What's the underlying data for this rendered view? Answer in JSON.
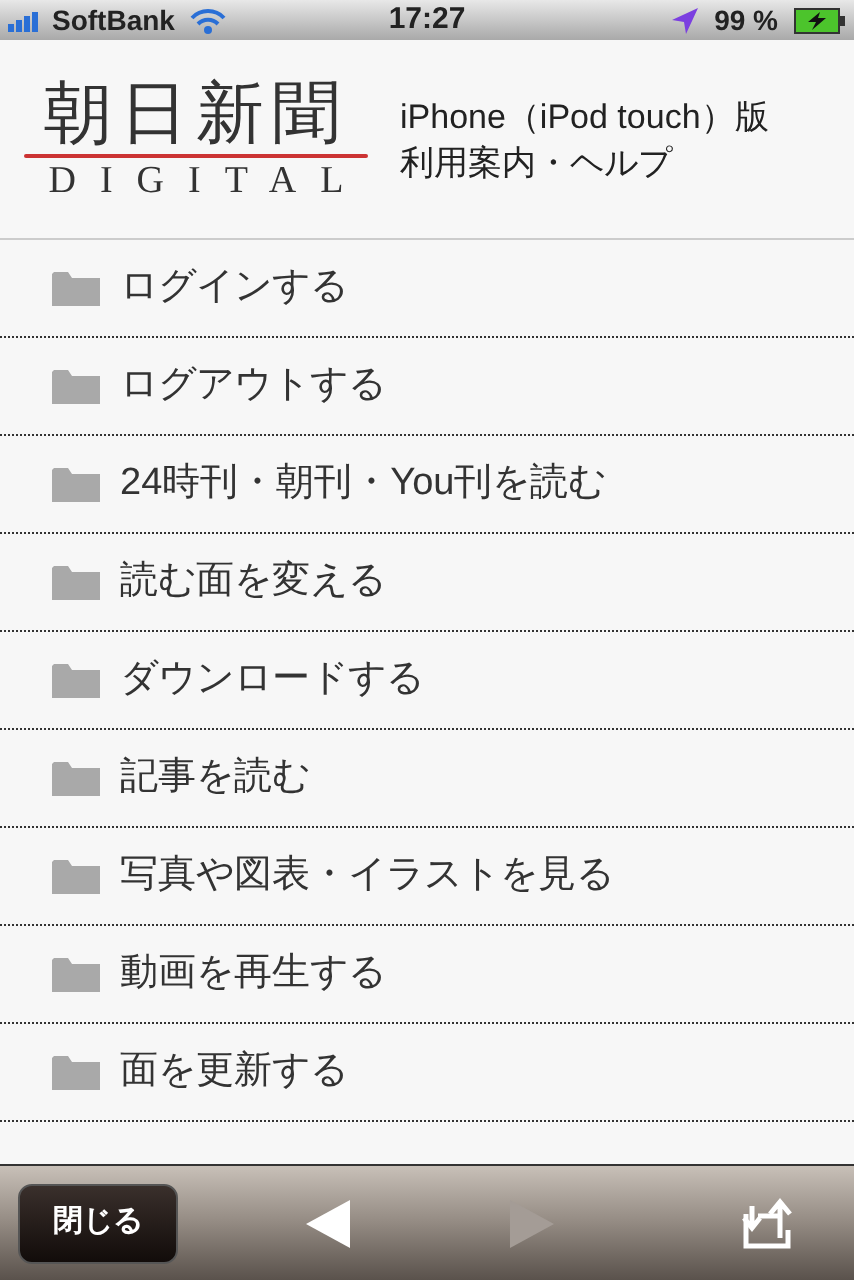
{
  "status_bar": {
    "carrier": "SoftBank",
    "time": "17:27",
    "battery": "99 %"
  },
  "header": {
    "logo_title": "朝日新聞",
    "logo_subtitle": "DIGITAL",
    "edition": "iPhone（iPod touch）版",
    "subtitle": "利用案内・ヘルプ"
  },
  "menu_items": [
    {
      "label": "ログインする"
    },
    {
      "label": "ログアウトする"
    },
    {
      "label": "24時刊・朝刊・You刊を読む"
    },
    {
      "label": "読む面を変える"
    },
    {
      "label": "ダウンロードする"
    },
    {
      "label": "記事を読む"
    },
    {
      "label": "写真や図表・イラストを見る"
    },
    {
      "label": "動画を再生する"
    },
    {
      "label": "面を更新する"
    }
  ],
  "toolbar": {
    "close_button": "閉じる",
    "back_disabled": false,
    "forward_disabled": true
  }
}
